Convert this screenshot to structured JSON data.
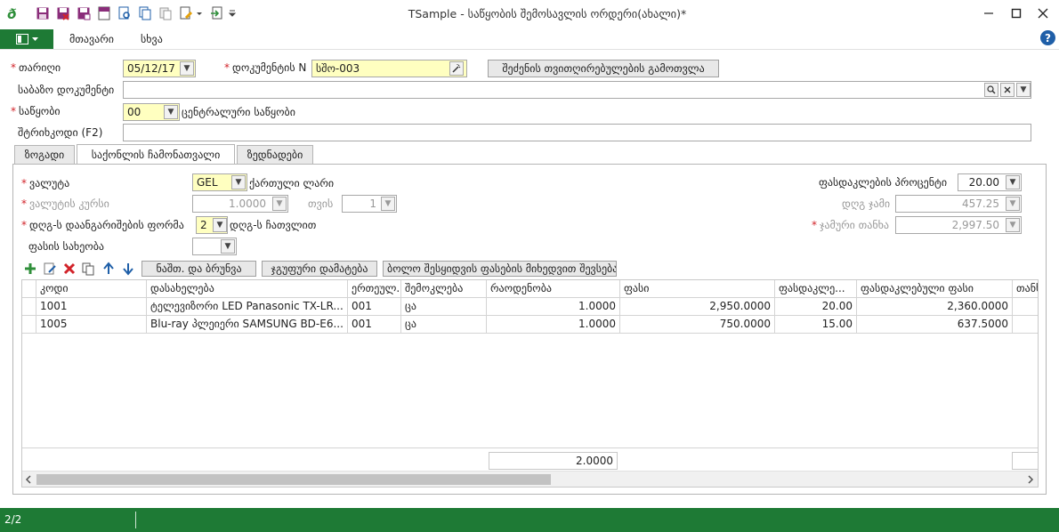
{
  "window": {
    "title": "TSample - საწყობის შემოსავლის ორდერი(ახალი)*"
  },
  "menu": {
    "items": [
      "მთავარი",
      "სხვა"
    ],
    "help": "?"
  },
  "form": {
    "date": {
      "label": "თარიღი",
      "value": "05/12/17"
    },
    "doc_number": {
      "label": "დოკუმენტის N",
      "value": "სშო-003"
    },
    "calc_button": "შეძენის თვითღირებულების გამოთვლა",
    "base_doc": {
      "label": "საბაზო დოკუმენტი",
      "value": ""
    },
    "warehouse": {
      "label": "საწყობი",
      "code": "00",
      "name": "ცენტრალური საწყობი"
    },
    "barcode": {
      "label": "შტრიხკოდი (F2)",
      "value": ""
    }
  },
  "tabs": [
    "ზოგადი",
    "საქონლის ჩამონათვალი",
    "ზედნადები"
  ],
  "panel": {
    "currency": {
      "label": "ვალუტა",
      "value": "GEL",
      "name": "ქართული ლარი"
    },
    "rate": {
      "label": "ვალუტის კურსი",
      "value": "1.0000"
    },
    "month": {
      "label": "თვის",
      "value": "1"
    },
    "vat_form": {
      "label": "დღგ-ს დაანგარიშების ფორმა",
      "value": "2",
      "name": "დღგ-ს ჩათვლით"
    },
    "price_type": {
      "label": "ფასის სახეობა",
      "value": ""
    },
    "discount_pct": {
      "label": "ფასდაკლების პროცენტი",
      "value": "20.00"
    },
    "vat_sum": {
      "label": "დღგ ჯამი",
      "value": "457.25"
    },
    "total": {
      "label": "ჯამური თანხა",
      "value": "2,997.50"
    },
    "buttons": {
      "return": "ნაშთ. და ბრუნვა",
      "group_add": "ჯგუფური დამატება",
      "last_price": "ბოლო შესყიდვის ფასების მიხედვით შევსება"
    }
  },
  "grid": {
    "columns": [
      "კოდი",
      "დასახელება",
      "ერთეულ...",
      "შემოკლება",
      "რაოდენობა",
      "ფასი",
      "ფასდაკლე...",
      "ფასდაკლებული ფასი",
      "თანხა"
    ],
    "rows": [
      [
        "1001",
        "ტელევიზორი LED Panasonic TX-LR...",
        "001",
        "ცა",
        "1.0000",
        "2,950.0000",
        "20.00",
        "2,360.0000",
        ""
      ],
      [
        "1005",
        "Blu-ray პლეიერი SAMSUNG BD-E6...",
        "001",
        "ცა",
        "1.0000",
        "750.0000",
        "15.00",
        "637.5000",
        ""
      ]
    ],
    "qty_total": "2.0000"
  },
  "status": {
    "page": "2/2"
  },
  "colors": {
    "accent_green": "#1e7a35",
    "required_red": "#d2232a",
    "field_yellow": "#ffffc0"
  }
}
